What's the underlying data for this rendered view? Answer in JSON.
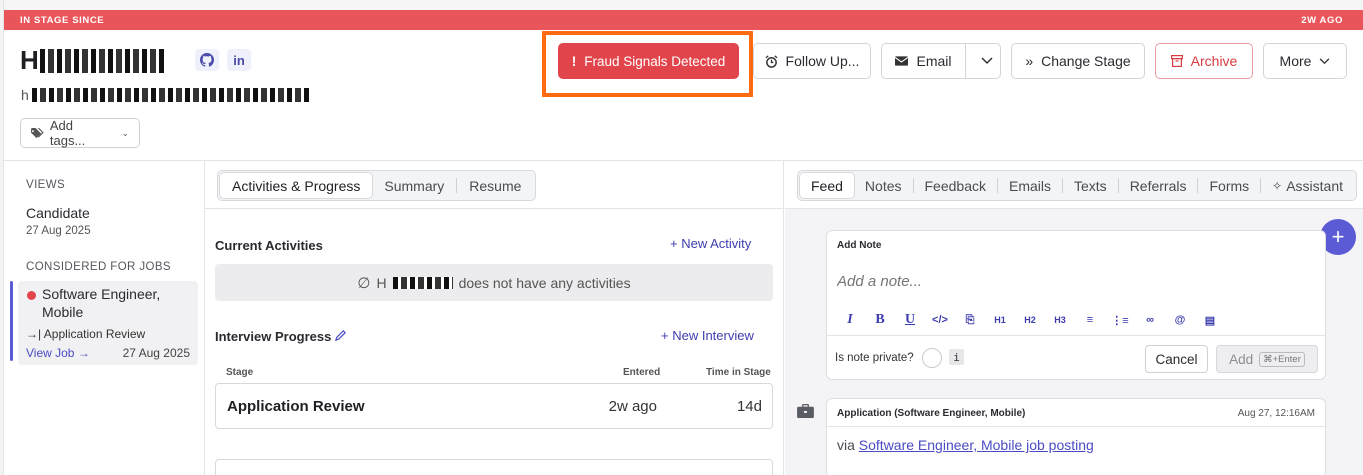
{
  "stage_bar": {
    "left": "IN STAGE SINCE",
    "right": "2W AGO"
  },
  "candidate": {
    "name_prefix": "H",
    "email_prefix": "h",
    "github_icon": "github-icon",
    "linkedin_label": "in"
  },
  "tags": {
    "label": "Add tags..."
  },
  "actions": {
    "fraud": "Fraud Signals Detected",
    "follow_up": "Follow Up...",
    "email": "Email",
    "change_stage": "Change Stage",
    "archive": "Archive",
    "more": "More"
  },
  "left": {
    "views_label": "VIEWS",
    "view_name": "Candidate",
    "view_date": "27 Aug 2025",
    "considered_label": "CONSIDERED FOR JOBS",
    "job_title": "Software Engineer, Mobile",
    "job_stage": "Application Review",
    "view_job": "View Job",
    "job_date": "27 Aug 2025"
  },
  "middle": {
    "tabs": [
      "Activities & Progress",
      "Summary",
      "Resume"
    ],
    "current_activities": "Current Activities",
    "new_activity": "New Activity",
    "empty_prefix": "H",
    "empty_suffix": "does not have any activities",
    "interview_progress": "Interview Progress",
    "new_interview": "New Interview",
    "col_stage": "Stage",
    "col_entered": "Entered",
    "col_time": "Time in Stage",
    "row_stage": "Application Review",
    "row_entered": "2w ago",
    "row_time": "14d"
  },
  "right": {
    "tabs": [
      "Feed",
      "Notes",
      "Feedback",
      "Emails",
      "Texts",
      "Referrals",
      "Forms",
      "Assistant"
    ],
    "note_title": "Add Note",
    "note_placeholder": "Add a note...",
    "private_label": "Is note private?",
    "info_glyph": "i",
    "cancel": "Cancel",
    "add": "Add",
    "add_shortcut": "⌘+Enter",
    "app_title": "Application (Software Engineer, Mobile)",
    "app_time": "Aug 27, 12:16AM",
    "app_via": "via",
    "app_link": "Software Engineer, Mobile job posting"
  },
  "colors": {
    "danger": "#e1454b",
    "highlight": "#ff6a13",
    "accent": "#5b5bd6"
  }
}
